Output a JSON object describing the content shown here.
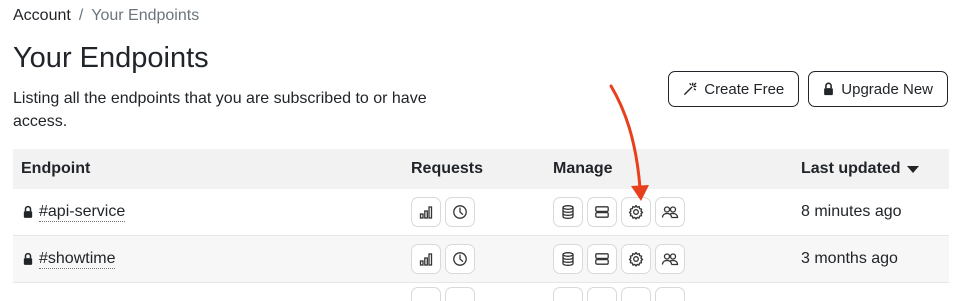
{
  "breadcrumb": {
    "root": "Account",
    "separator": "/",
    "current": "Your Endpoints"
  },
  "page": {
    "title": "Your Endpoints",
    "subtitle": "Listing all the endpoints that you are subscribed to or have access."
  },
  "actions": {
    "create_label": "Create Free",
    "create_icon": "magic-wand-icon",
    "upgrade_label": "Upgrade New",
    "upgrade_icon": "lock-icon"
  },
  "table": {
    "columns": {
      "endpoint": "Endpoint",
      "requests": "Requests",
      "manage": "Manage",
      "last_updated": "Last updated"
    },
    "sort": {
      "column": "last_updated",
      "direction": "descending"
    },
    "rows": [
      {
        "name": "#api-service",
        "updated": "8 minutes ago",
        "locked": true
      },
      {
        "name": "#showtime",
        "updated": "3 months ago",
        "locked": true
      }
    ]
  },
  "colors": {
    "annotation_arrow": "#e8401c",
    "header_bg": "#f2f2f2",
    "text": "#212529",
    "muted": "#6c757d"
  }
}
